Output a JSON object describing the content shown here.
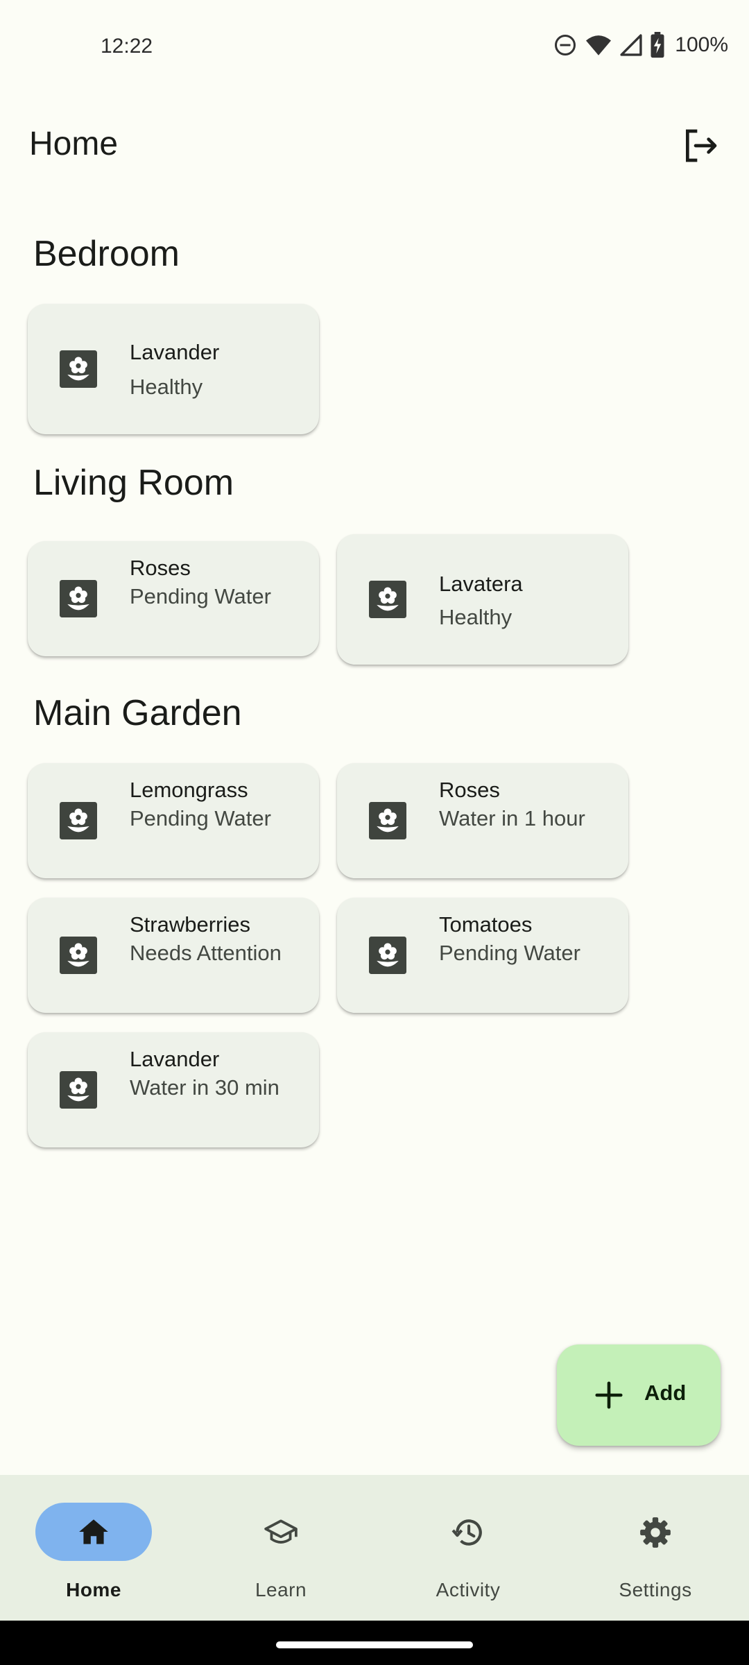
{
  "status_bar": {
    "time": "12:22",
    "battery": "100%",
    "icons": [
      "do-not-disturb-icon",
      "wifi-icon",
      "signal-icon",
      "battery-charging-icon"
    ]
  },
  "header": {
    "title": "Home",
    "logout_icon": "logout-icon"
  },
  "sections": [
    {
      "title": "Bedroom",
      "plants": [
        {
          "name": "Lavander",
          "status": "Healthy"
        }
      ]
    },
    {
      "title": "Living Room",
      "plants": [
        {
          "name": "Roses",
          "status": "Pending Water"
        },
        {
          "name": "Lavatera",
          "status": "Healthy"
        }
      ]
    },
    {
      "title": "Main Garden",
      "plants": [
        {
          "name": "Lemongrass",
          "status": "Pending Water"
        },
        {
          "name": "Roses",
          "status": "Water in 1 hour"
        },
        {
          "name": "Strawberries",
          "status": "Needs Attention"
        },
        {
          "name": "Tomatoes",
          "status": "Pending Water"
        },
        {
          "name": "Lavander",
          "status": "Water in 30 min"
        }
      ]
    }
  ],
  "fab": {
    "label": "Add",
    "icon": "plus-icon"
  },
  "bottom_nav": {
    "items": [
      {
        "label": "Home",
        "icon": "home-icon",
        "active": true
      },
      {
        "label": "Learn",
        "icon": "school-icon",
        "active": false
      },
      {
        "label": "Activity",
        "icon": "history-icon",
        "active": false
      },
      {
        "label": "Settings",
        "icon": "gear-icon",
        "active": false
      }
    ]
  },
  "colors": {
    "background": "#fcfdf6",
    "card": "#eef2ea",
    "fab": "#c4f0b8",
    "nav_background": "#e8efe2",
    "nav_active_pill": "#7fb3ee"
  }
}
